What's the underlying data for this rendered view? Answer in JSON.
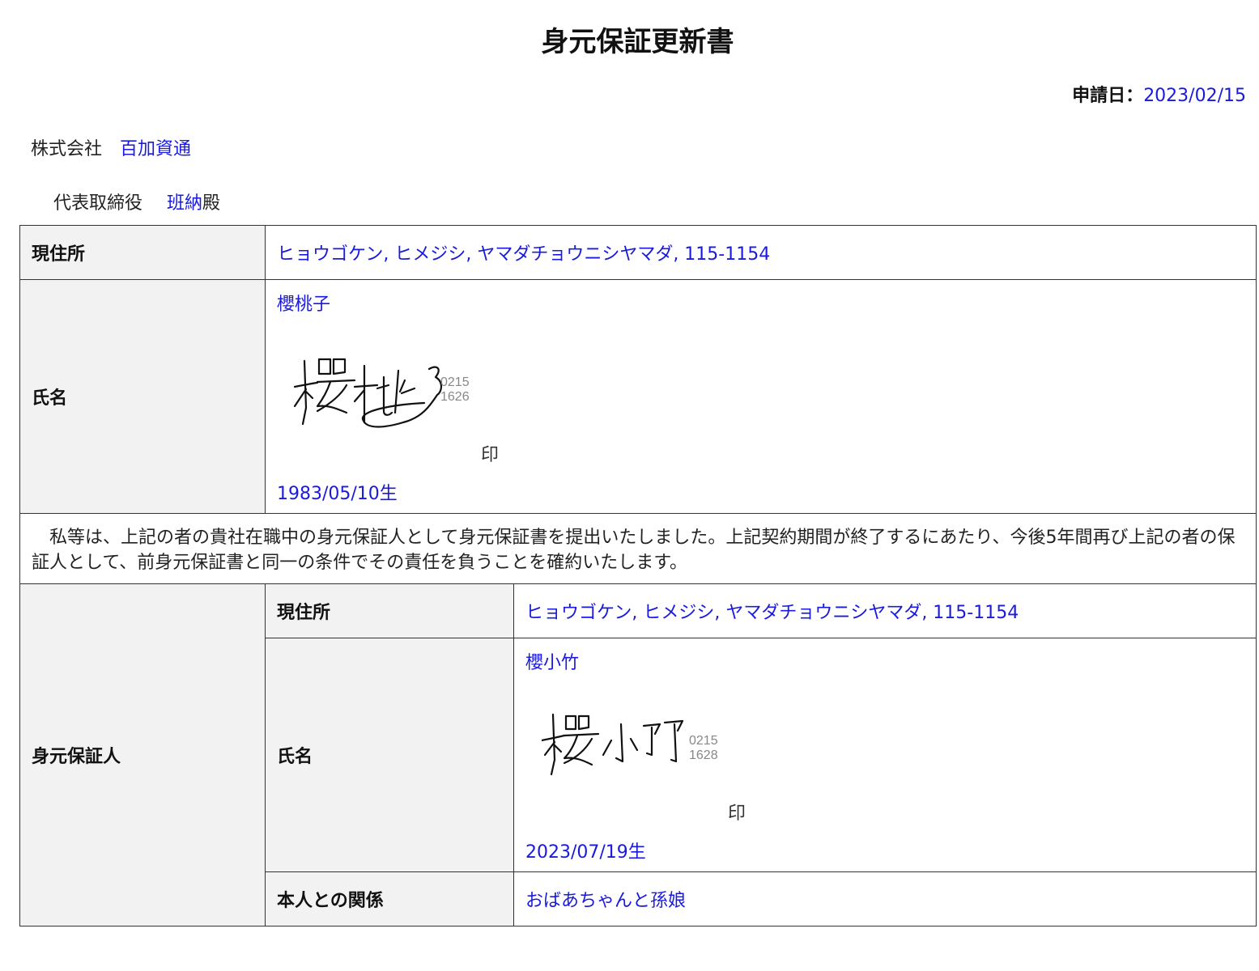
{
  "title": "身元保証更新書",
  "application_date": {
    "label": "申請日：",
    "value": "2023/02/15"
  },
  "company": {
    "prefix": "株式会社",
    "name": "百加資通"
  },
  "representative": {
    "title": "代表取締役",
    "name": "班納",
    "suffix": "殿"
  },
  "employee": {
    "address_label": "現住所",
    "address": "ヒョウゴケン, ヒメジシ, ヤマダチョウニシヤマダ, 115-1154",
    "name_label": "氏名",
    "name": "櫻桃子",
    "signature_numbers": [
      "0215",
      "1626"
    ],
    "seal": "印",
    "birth_date": "1983/05/10生"
  },
  "statement": "　私等は、上記の者の貴社在職中の身元保証人として身元保証書を提出いたしました。上記契約期間が終了するにあたり、今後5年間再び上記の者の保証人として、前身元保証書と同一の条件でその責任を負うことを確約いたします。",
  "guarantor": {
    "section_label": "身元保証人",
    "address_label": "現住所",
    "address": "ヒョウゴケン, ヒメジシ, ヤマダチョウニシヤマダ, 115-1154",
    "name_label": "氏名",
    "name": "櫻小竹",
    "signature_numbers": [
      "0215",
      "1628"
    ],
    "seal": "印",
    "birth_date": "2023/07/19生",
    "relation_label": "本人との関係",
    "relation": "おばあちゃんと孫娘"
  },
  "colors": {
    "value_text": "#1a1adf",
    "label_background": "#f2f2f2",
    "border": "#333333"
  }
}
